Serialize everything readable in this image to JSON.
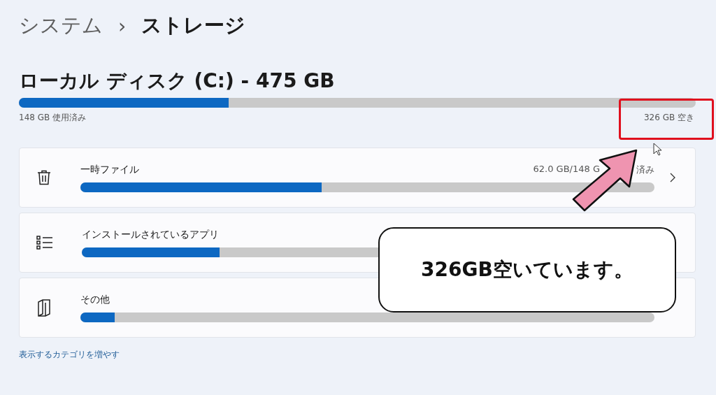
{
  "breadcrumb": {
    "parent": "システム",
    "separator": "›",
    "current": "ストレージ"
  },
  "drive": {
    "title": "ローカル ディスク (C:) - 475 GB",
    "level": 0.31,
    "used": "148 GB 使用済み",
    "free": "326 GB 空き"
  },
  "categories": [
    {
      "name": "一時ファイル",
      "kind": "trash",
      "level": 0.42,
      "usage_parts": [
        "62.0 GB/148 G",
        "済み"
      ],
      "chevron": true
    },
    {
      "name": "インストールされているアプリ",
      "kind": "list",
      "level": 0.24,
      "chevron": false
    },
    {
      "name": "その他",
      "kind": "file",
      "level": 0.06,
      "chevron": false
    }
  ],
  "more_link": "表示するカテゴリを増やす",
  "annotation": {
    "callout": "326GB空いています。"
  }
}
